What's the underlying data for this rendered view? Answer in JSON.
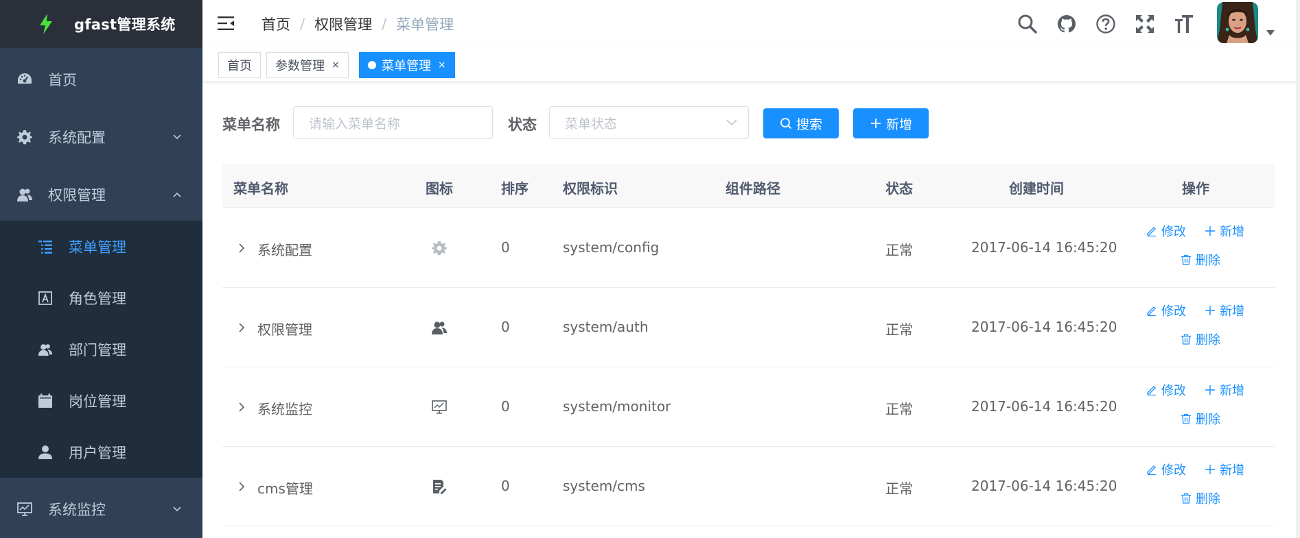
{
  "app": {
    "title": "gfast管理系统"
  },
  "sidebar": {
    "items": [
      {
        "label": "首页",
        "icon": "dashboard-icon"
      },
      {
        "label": "系统配置",
        "icon": "gear-icon"
      },
      {
        "label": "权限管理",
        "icon": "peoples-icon"
      },
      {
        "label": "系统监控",
        "icon": "monitor-icon"
      }
    ],
    "subitems": [
      {
        "label": "菜单管理",
        "icon": "tree-table-icon",
        "active": true
      },
      {
        "label": "角色管理",
        "icon": "role-icon"
      },
      {
        "label": "部门管理",
        "icon": "peoples-icon"
      },
      {
        "label": "岗位管理",
        "icon": "post-icon"
      },
      {
        "label": "用户管理",
        "icon": "user-icon"
      }
    ]
  },
  "breadcrumb": [
    "首页",
    "权限管理",
    "菜单管理"
  ],
  "breadcrumb_sep": "/",
  "tags": [
    {
      "label": "首页",
      "closable": false
    },
    {
      "label": "参数管理",
      "closable": true
    },
    {
      "label": "菜单管理",
      "closable": true,
      "active": true
    }
  ],
  "tag_close": "×",
  "search": {
    "menu_name_label": "菜单名称",
    "menu_name_placeholder": "请输入菜单名称",
    "status_label": "状态",
    "status_placeholder": "菜单状态",
    "search_button": "搜索",
    "add_button": "新增"
  },
  "table": {
    "columns": [
      "菜单名称",
      "图标",
      "排序",
      "权限标识",
      "组件路径",
      "状态",
      "创建时间",
      "操作"
    ],
    "rows": [
      {
        "name": "系统配置",
        "icon": "gear-icon",
        "order": "0",
        "perm": "system/config",
        "component": "",
        "status": "正常",
        "created": "2017-06-14 16:45:20"
      },
      {
        "name": "权限管理",
        "icon": "peoples-icon",
        "order": "0",
        "perm": "system/auth",
        "component": "",
        "status": "正常",
        "created": "2017-06-14 16:45:20"
      },
      {
        "name": "系统监控",
        "icon": "monitor-icon",
        "order": "0",
        "perm": "system/monitor",
        "component": "",
        "status": "正常",
        "created": "2017-06-14 16:45:20"
      },
      {
        "name": "cms管理",
        "icon": "edit-doc-icon",
        "order": "0",
        "perm": "system/cms",
        "component": "",
        "status": "正常",
        "created": "2017-06-14 16:45:20"
      }
    ],
    "actions": {
      "edit": "修改",
      "add": "新增",
      "delete": "删除"
    }
  },
  "colors": {
    "sidebar_bg": "#304156",
    "submenu_bg": "#1f2d3d",
    "logo_bg": "#2b2f3a",
    "primary": "#1890ff",
    "active_menu": "#409eff"
  }
}
